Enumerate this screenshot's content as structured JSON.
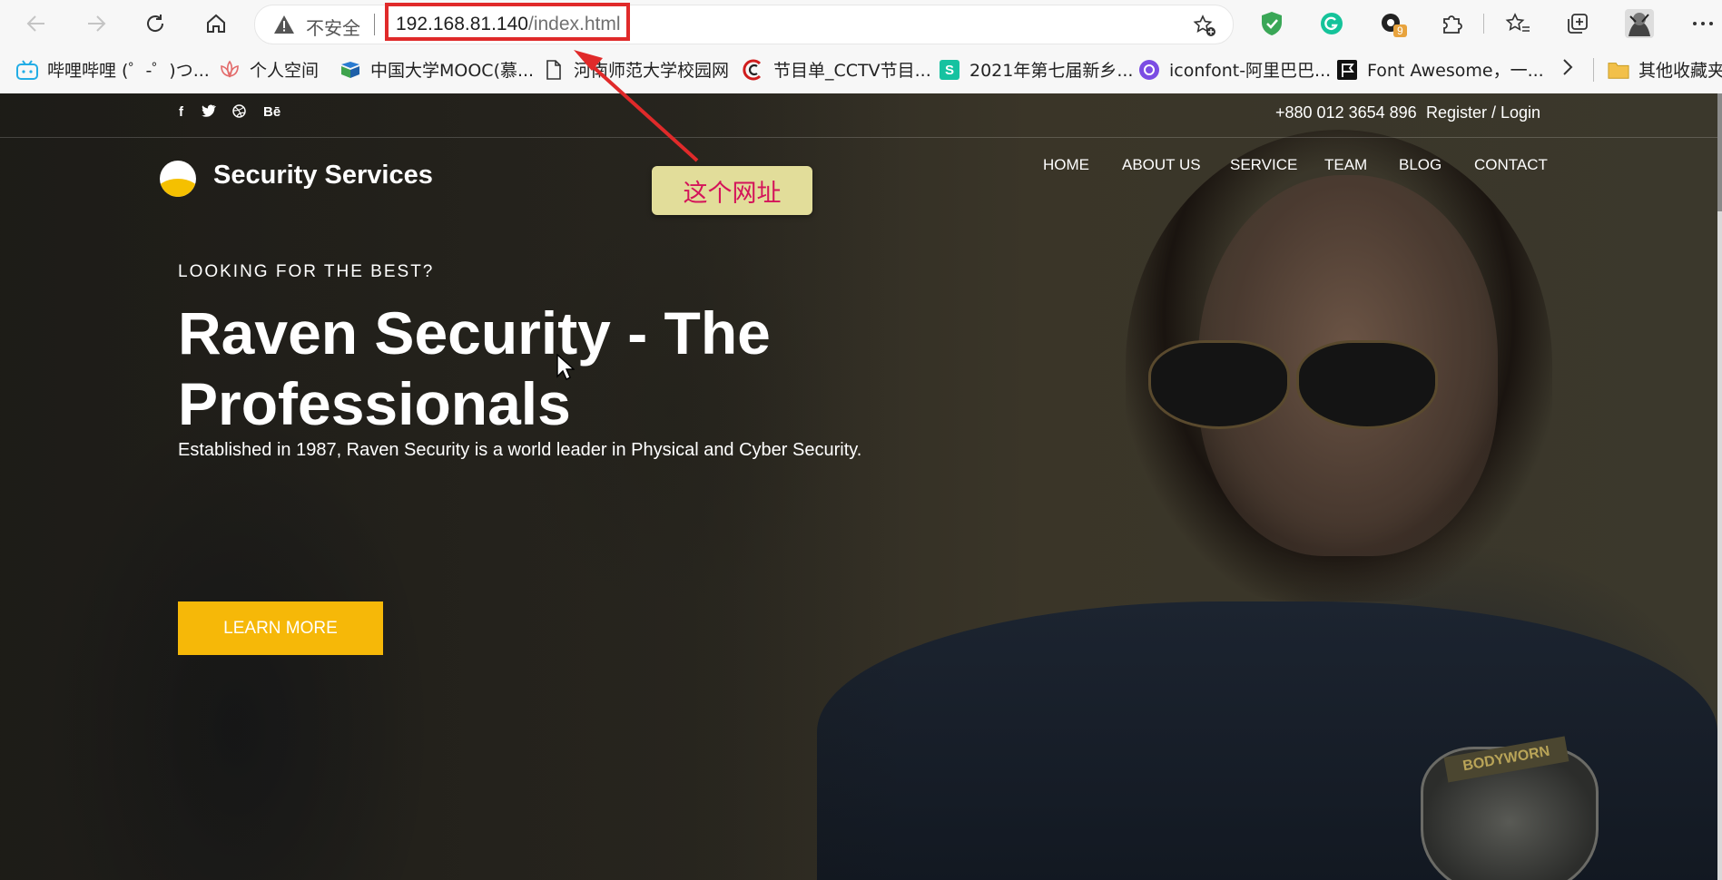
{
  "browser": {
    "nav": {
      "back_icon": "arrow-left-icon",
      "forward_icon": "arrow-right-icon",
      "refresh_icon": "refresh-icon",
      "home_icon": "home-icon"
    },
    "security_label": "不安全",
    "url_host": "192.168.81.140",
    "url_path": "/index.html",
    "extensions": {
      "shield_ext_icon": "shield-check-icon",
      "grammarly_icon": "grammarly-icon",
      "badge_count": "9"
    },
    "bookmarks": [
      {
        "label": "哔哩哔哩 (゜-゜)つ...",
        "icon": "bilibili-icon"
      },
      {
        "label": "个人空间",
        "icon": "lotus-icon"
      },
      {
        "label": "中国大学MOOC(慕...",
        "icon": "mooc-icon"
      },
      {
        "label": "河南师范大学校园网",
        "icon": "page-icon"
      },
      {
        "label": "节目单_CCTV节目...",
        "icon": "cctv-icon"
      },
      {
        "label": "2021年第七届新乡...",
        "icon": "s-icon"
      },
      {
        "label": "iconfont-阿里巴巴...",
        "icon": "iconfont-icon"
      },
      {
        "label": "Font Awesome，一...",
        "icon": "flag-icon"
      },
      {
        "label": "其他收藏夹",
        "icon": "folder-icon"
      }
    ]
  },
  "site": {
    "social": [
      "f",
      "t",
      "d",
      "Bē"
    ],
    "phone": "+880 012 3654 896",
    "auth": "Register / Login",
    "brand": "Security Services",
    "nav": [
      "HOME",
      "ABOUT US",
      "SERVICE",
      "TEAM",
      "BLOG",
      "CONTACT"
    ],
    "hero": {
      "eyebrow": "LOOKING FOR THE BEST?",
      "title": "Raven Security - The Professionals",
      "description": "Established in 1987, Raven Security is a world leader in Physical and Cyber Security.",
      "cta": "LEARN MORE"
    },
    "badge_text": "BODYWORN"
  },
  "annotation": {
    "note": "这个网址",
    "color": "#e02a2a"
  }
}
